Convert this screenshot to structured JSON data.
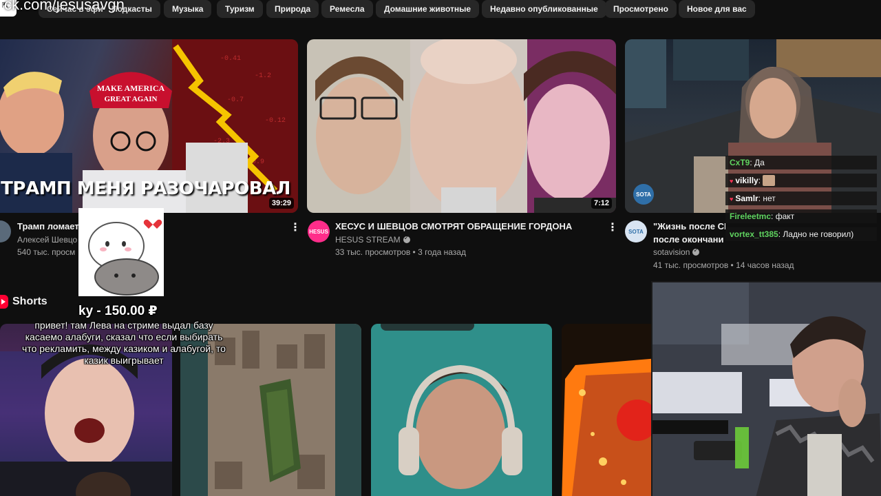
{
  "overlay_url": "ck.com/jesusavgn",
  "chips": [
    "Сейчас в эфире",
    "Подкасты",
    "Музыка",
    "Туризм",
    "Природа",
    "Ремесла",
    "Домашние животные",
    "Недавно опубликованные",
    "Просмотрено",
    "Новое для вас"
  ],
  "videos": [
    {
      "title": "Трамп ломает",
      "channel": "Алексей Шевцо",
      "views": "540 тыс. просм",
      "duration": "39:29",
      "thumb_text": "ТРАМП МЕНЯ РАЗОЧАРОВАЛ"
    },
    {
      "title": "ХЕСУС И ШЕВЦОВ СМОТРЯТ ОБРАЩЕНИЕ ГОРДОНА",
      "channel": "HESUS STREAM",
      "views": "33 тыс. просмотров • 3 года назад",
      "duration": "7:12",
      "avatar_text": "HESUS"
    },
    {
      "title": "\"Жизнь после СВ",
      "title_line2": "после окончани",
      "channel": "sotavision",
      "views": "41 тыс. просмотров • 14 часов назад",
      "avatar_text": "SOTA"
    }
  ],
  "shorts_label": "Shorts",
  "donation": {
    "amount": "ky - 150.00 ₽",
    "message": "привет! там Лева на стриме выдал базу касаемо алабуги, сказал что если выбирать что рекламить, между казиком и алабугой, то казик выигрывает"
  },
  "chat": [
    {
      "nick": "CxT9",
      "text": "Да",
      "color": "#5fd35f"
    },
    {
      "nick": "vikilly",
      "text": "",
      "color": "#ffffff",
      "heart": true,
      "emote": true
    },
    {
      "nick": "Samlr",
      "text": "нет",
      "color": "#ffffff",
      "heart": true
    },
    {
      "nick": "Fireleetmc",
      "text": "факт",
      "color": "#5fd35f"
    },
    {
      "nick": "vortex_tt385",
      "text": "Ладно не говорил)",
      "color": "#5fd35f"
    }
  ],
  "colors": {
    "background": "#0f0f0f",
    "chip": "#272727",
    "meta_text": "#aaaaaa",
    "chat_green": "#5fd35f"
  }
}
